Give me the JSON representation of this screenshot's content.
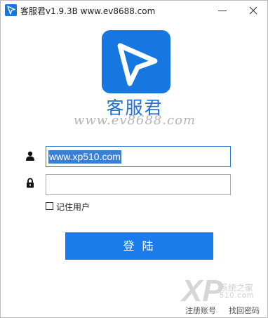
{
  "window": {
    "title": "客服君v1.9.3B www.ev8688.com",
    "app_icon": "paper-plane-icon",
    "controls": {
      "minimize_icon": "minimize-icon",
      "close_icon": "close-icon"
    }
  },
  "brand": {
    "logo_icon": "paper-plane-icon",
    "name": "客服君",
    "website": "www.ev8688.com"
  },
  "login_form": {
    "username_icon": "user-icon",
    "username_value": "www.xp510.com",
    "password_icon": "lock-icon",
    "password_value": "",
    "remember_label": "记住用户",
    "remember_checked": false,
    "login_label": "登 陆"
  },
  "footer": {
    "register_label": "注册账号",
    "forgot_label": "找回密码"
  },
  "watermark": {
    "logo_text": "XP",
    "line1": "系统之家",
    "line2": "510.com"
  },
  "colors": {
    "accent": "#1a7ceb",
    "brand_text": "#1e6fd0",
    "selection": "#3a7fd6"
  }
}
